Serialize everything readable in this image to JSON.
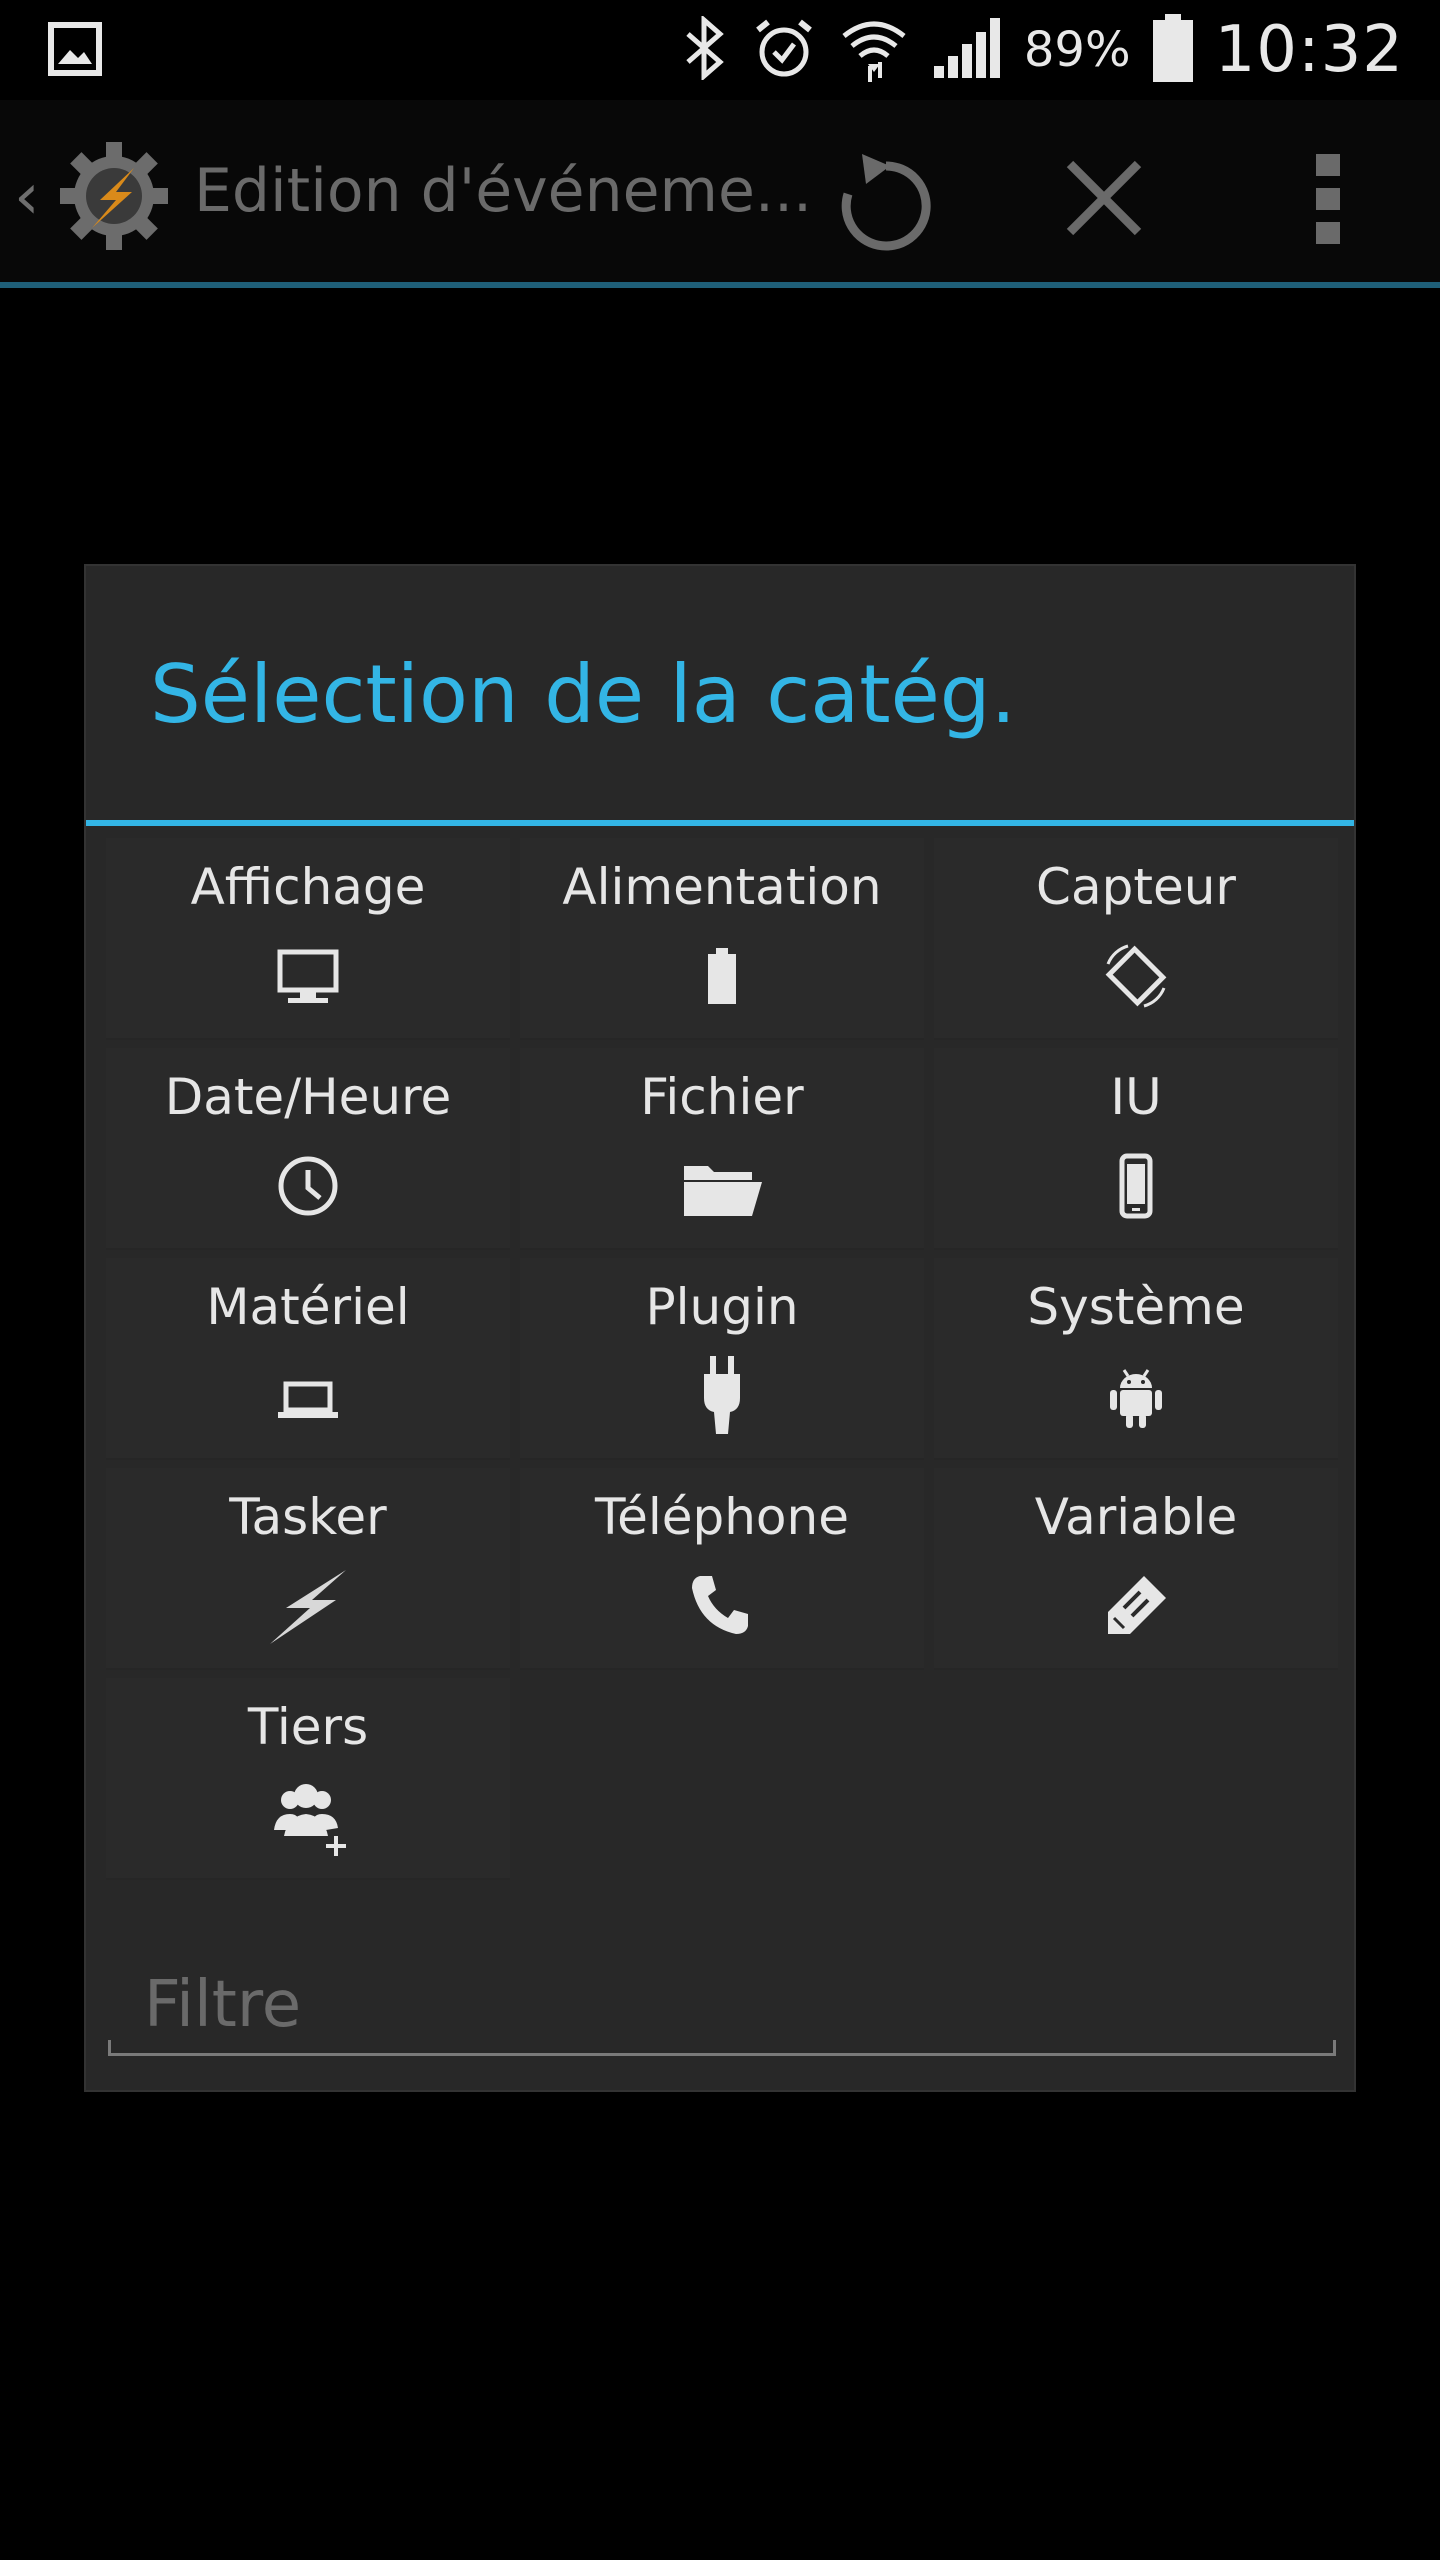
{
  "status_bar": {
    "battery_percent": "89%",
    "time": "10:32",
    "icons": [
      "gallery-icon",
      "bluetooth-icon",
      "alarm-icon",
      "wifi-icon",
      "signal-icon",
      "battery-icon"
    ]
  },
  "action_bar": {
    "title": "Edition d'événeme...",
    "icons": [
      "tasker-icon",
      "refresh-icon",
      "close-icon",
      "overflow-menu-icon"
    ]
  },
  "dialog": {
    "title": "Sélection de la catég.",
    "accent_color": "#33b5e5",
    "categories": [
      {
        "label": "Affichage",
        "icon": "monitor-icon"
      },
      {
        "label": "Alimentation",
        "icon": "battery-icon"
      },
      {
        "label": "Capteur",
        "icon": "screen-rotation-icon"
      },
      {
        "label": "Date/Heure",
        "icon": "clock-icon"
      },
      {
        "label": "Fichier",
        "icon": "folder-icon"
      },
      {
        "label": "IU",
        "icon": "phone-device-icon"
      },
      {
        "label": "Matériel",
        "icon": "laptop-icon"
      },
      {
        "label": "Plugin",
        "icon": "plug-icon"
      },
      {
        "label": "Système",
        "icon": "android-icon"
      },
      {
        "label": "Tasker",
        "icon": "lightning-icon"
      },
      {
        "label": "Téléphone",
        "icon": "phone-handset-icon"
      },
      {
        "label": "Variable",
        "icon": "pencil-tag-icon"
      },
      {
        "label": "Tiers",
        "icon": "add-users-icon"
      }
    ],
    "filter": {
      "placeholder": "Filtre",
      "value": ""
    }
  }
}
